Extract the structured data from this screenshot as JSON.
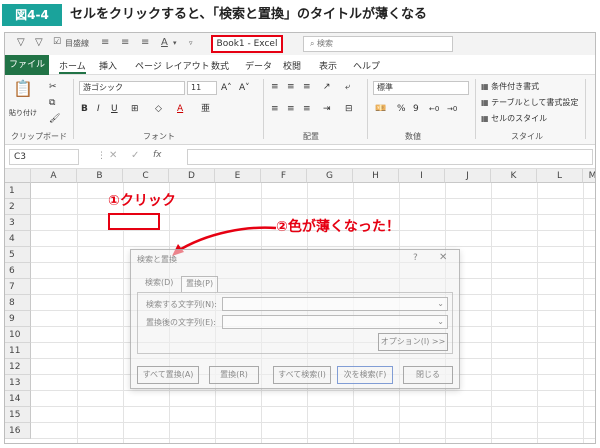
{
  "caption": {
    "badge": "図4-4",
    "text": "セルをクリックすると、「検索と置換」のタイトルが薄くなる"
  },
  "window": {
    "title": "Book1  -  Excel",
    "search_placeholder": "検索",
    "qat_items": [
      "filter-icon",
      "clear-filter-icon",
      "目盛線",
      "align-left-icon",
      "align-center-icon",
      "align-right-icon",
      "underline-icon"
    ],
    "qat_gridline_label": "目盛線"
  },
  "ribbon": {
    "tabs": [
      "ファイル",
      "ホーム",
      "挿入",
      "ページ レイアウト",
      "数式",
      "データ",
      "校閲",
      "表示",
      "ヘルプ"
    ],
    "active_tab": "ホーム",
    "paste_label": "貼り付け",
    "font_name": "游ゴシック",
    "font_size": "11",
    "number_format": "標準",
    "conditional_format": "条件付き書式",
    "format_as_table": "テーブルとして書式設定",
    "cell_styles": "セルのスタイル",
    "groups": [
      "クリップボード",
      "フォント",
      "配置",
      "数値",
      "スタイル"
    ]
  },
  "formula_bar": {
    "name_box": "C3",
    "fx": "fx",
    "value": ""
  },
  "grid": {
    "columns": [
      "A",
      "B",
      "C",
      "D",
      "E",
      "F",
      "G",
      "H",
      "I",
      "J",
      "K",
      "L",
      "M"
    ],
    "rows": [
      "1",
      "2",
      "3",
      "4",
      "5",
      "6",
      "7",
      "8",
      "9",
      "10",
      "11",
      "12",
      "13",
      "14",
      "15",
      "16"
    ],
    "selected_cell": "C3"
  },
  "annotations": {
    "step1": "①クリック",
    "step2": "②色が薄くなった！"
  },
  "dialog": {
    "title": "検索と置換",
    "help": "?",
    "close": "✕",
    "tabs": [
      "検索(D)",
      "置換(P)"
    ],
    "active_tab": "置換(P)",
    "find_label": "検索する文字列(N):",
    "replace_label": "置換後の文字列(E):",
    "find_value": "",
    "replace_value": "",
    "options_button": "オプション(I) >>",
    "buttons": {
      "replace_all": "すべて置換(A)",
      "replace": "置換(R)",
      "find_all": "すべて検索(I)",
      "find_next": "次を検索(F)",
      "close": "閉じる"
    }
  },
  "colors": {
    "accent": "#217346",
    "highlight": "#e60012",
    "caption_badge": "#1aa39b"
  }
}
